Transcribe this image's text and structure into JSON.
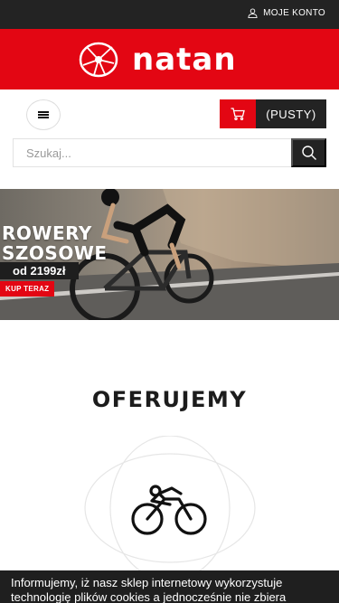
{
  "header": {
    "account_label": "MOJE KONTO",
    "account_icon": "user-icon",
    "logo_text": "natan",
    "logo_icon": "natan-wheel-logo",
    "brand_red": "#e30613",
    "dark": "#232323"
  },
  "toolbar": {
    "menu_icon": "hamburger-icon",
    "cart_icon": "cart-icon",
    "cart_label": "(PUSTY)"
  },
  "search": {
    "placeholder": "Szukaj...",
    "value": "",
    "button_icon": "search-icon"
  },
  "banner": {
    "title_line1": "ROWERY",
    "title_line2": "SZOSOWE",
    "price": "od 2199zł",
    "cta": "KUP TERAZ"
  },
  "offer": {
    "title": "OFERUJEMY",
    "icon": "cyclist-icon"
  },
  "cookie": {
    "line1": "Informujemy, iż nasz sklep internetowy wykorzystuje",
    "line2": "technologię plików cookies a jednocześnie nie zbiera"
  }
}
